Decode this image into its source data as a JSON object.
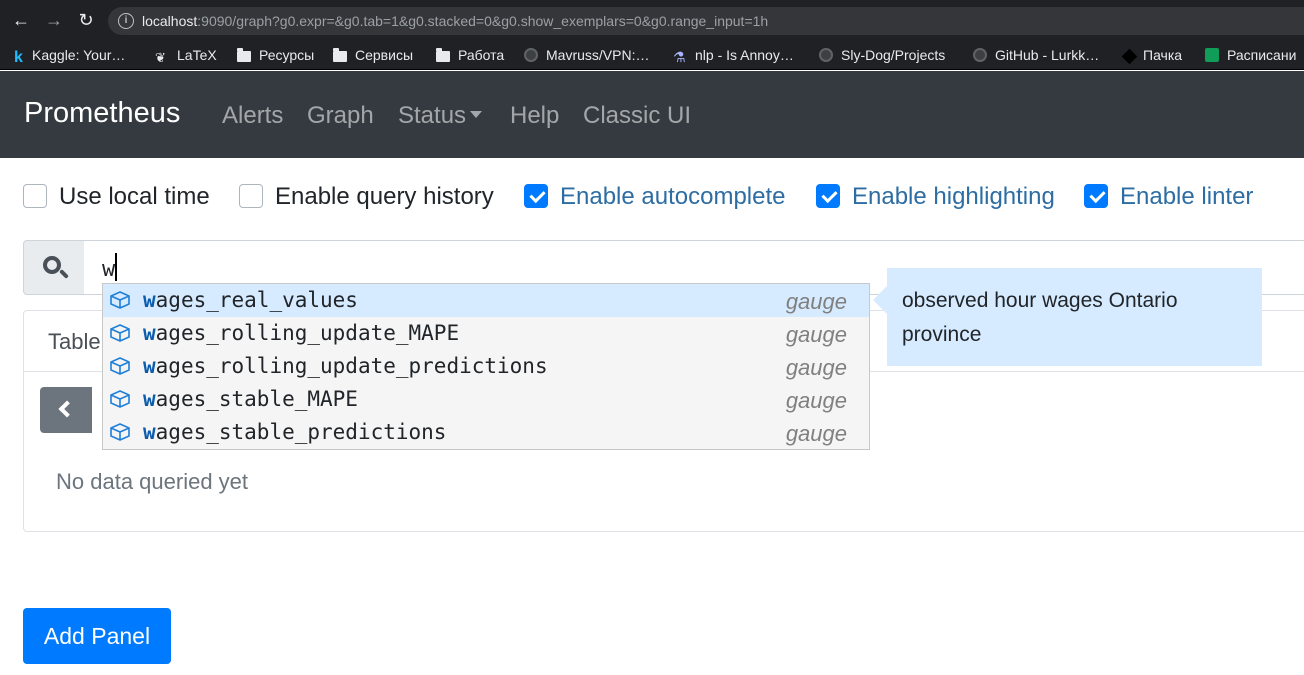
{
  "browser": {
    "url_host": "localhost",
    "url_rest": ":9090/graph?g0.expr=&g0.tab=1&g0.stacked=0&g0.show_exemplars=0&g0.range_input=1h",
    "bookmarks": [
      {
        "label": "Kaggle: Your…",
        "icon": "kaggle-icon"
      },
      {
        "label": "LaTeX",
        "icon": "overleaf-icon"
      },
      {
        "label": "Ресурсы",
        "icon": "folder-icon"
      },
      {
        "label": "Сервисы",
        "icon": "folder-icon"
      },
      {
        "label": "Работа",
        "icon": "folder-icon"
      },
      {
        "label": "Mavruss/VPN:…",
        "icon": "github-icon"
      },
      {
        "label": "nlp - Is Annoy…",
        "icon": "stackexchange-icon"
      },
      {
        "label": "Sly-Dog/Projects",
        "icon": "github-icon"
      },
      {
        "label": "GitHub - Lurkk…",
        "icon": "github-icon"
      },
      {
        "label": "Пачка",
        "icon": "pachca-icon"
      },
      {
        "label": "Расписани",
        "icon": "sheets-icon"
      }
    ]
  },
  "navbar": {
    "brand": "Prometheus",
    "links": [
      "Alerts",
      "Graph",
      "Status",
      "Help",
      "Classic UI"
    ]
  },
  "options": [
    {
      "label": "Use local time",
      "checked": false
    },
    {
      "label": "Enable query history",
      "checked": false
    },
    {
      "label": "Enable autocomplete",
      "checked": true
    },
    {
      "label": "Enable highlighting",
      "checked": true
    },
    {
      "label": "Enable linter",
      "checked": true
    }
  ],
  "expression": {
    "value": "w"
  },
  "autocomplete": {
    "items": [
      {
        "match": "w",
        "rest": "ages_real_values",
        "type": "gauge"
      },
      {
        "match": "w",
        "rest": "ages_rolling_update_MAPE",
        "type": "gauge"
      },
      {
        "match": "w",
        "rest": "ages_rolling_update_predictions",
        "type": "gauge"
      },
      {
        "match": "w",
        "rest": "ages_stable_MAPE",
        "type": "gauge"
      },
      {
        "match": "w",
        "rest": "ages_stable_predictions",
        "type": "gauge"
      }
    ],
    "info": "observed hour wages Ontario province"
  },
  "panel": {
    "tab_table": "Table",
    "no_data": "No data queried yet"
  },
  "add_panel_label": "Add Panel",
  "colors": {
    "navbar_bg": "#343a40",
    "primary": "#007bff",
    "selected_item": "#d6ebff",
    "match_text": "#0b5cad"
  }
}
